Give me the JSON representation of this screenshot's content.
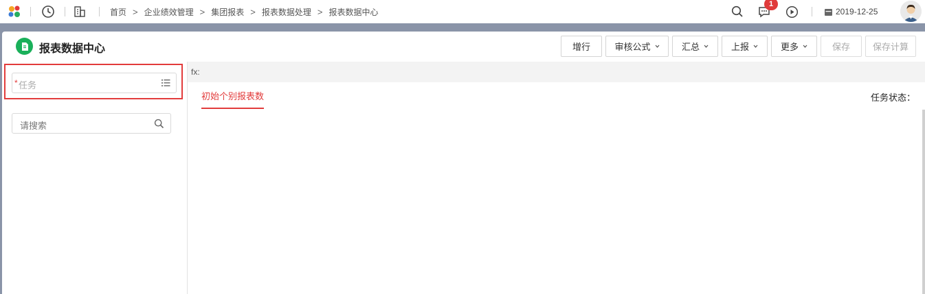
{
  "topbar": {
    "icons": [
      "app-logo-icon",
      "history-clock-icon",
      "building-icon"
    ],
    "breadcrumb": [
      "首页",
      "企业绩效管理",
      "集团报表",
      "报表数据处理",
      "报表数据中心"
    ],
    "notification_count": "1",
    "date": "2019-12-25"
  },
  "page": {
    "title": "报表数据中心",
    "buttons": {
      "add_row": "增行",
      "audit_formula": "审核公式",
      "summary": "汇总",
      "report_up": "上报",
      "more": "更多",
      "save": "保存",
      "save_calc": "保存计算"
    }
  },
  "left": {
    "task_required_mark": "*",
    "task_placeholder": "任务",
    "search_placeholder": "请搜索"
  },
  "right": {
    "fx_label": "fx:",
    "tab": "初始个别报表数",
    "status_label": "任务状态："
  },
  "colors": {
    "accent_red": "#e23b3b",
    "title_icon_green": "#1ab05a",
    "band": "#8a94a8"
  }
}
